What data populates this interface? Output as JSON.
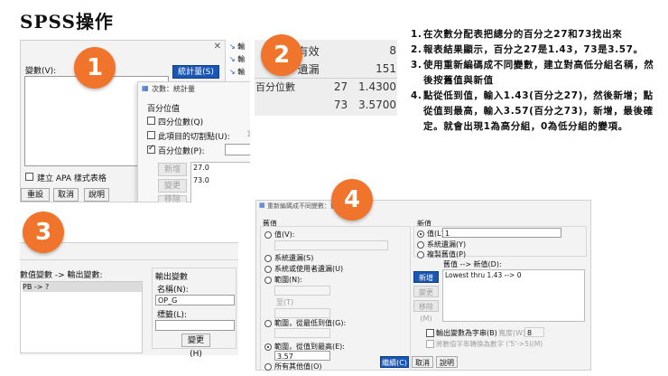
{
  "title": {
    "latin": "SPSS",
    "cjk": "操作"
  },
  "badges": [
    "1",
    "2",
    "3",
    "4"
  ],
  "panel1": {
    "vars_label": "變數(V):",
    "stats_button": "統計量(S)",
    "apa_label": "建立 APA 樣式表格",
    "reset": "重設(R)",
    "cancel": "取消",
    "help": "說明",
    "right_items": [
      "輸",
      "輸",
      "輸"
    ],
    "sub": {
      "title": "次數：統計量",
      "section": "百分位值",
      "quartiles": "四分位數(Q)",
      "cutpoints": "此項目的切割點(U):",
      "cutpoints_value": "10",
      "percentiles": "百分位數(P):",
      "add": "新增(A)",
      "change": "變更(C)",
      "remove": "移除(M)",
      "list": [
        "27.0",
        "73.0"
      ]
    }
  },
  "panel2": {
    "rows": [
      {
        "c1": "",
        "c2": "有效",
        "c3": "",
        "c4": "8"
      },
      {
        "c1": "",
        "c2": "遺漏",
        "c3": "",
        "c4": "151"
      },
      {
        "c1": "百分位數",
        "c2": "",
        "c3": "27",
        "c4": "1.4300"
      },
      {
        "c1": "",
        "c2": "",
        "c3": "73",
        "c4": "3.5700"
      }
    ]
  },
  "panel3": {
    "header_left": "數值變數 -> 輸出變數:",
    "list_item": "PB -> ?",
    "output_var": "輸出變數",
    "name_label": "名稱(N):",
    "name_value": "OP_G",
    "label_label": "標籤(L):",
    "change_button": "變更(H)"
  },
  "panel4": {
    "title": "重新編碼成不同變數：舊值與新值",
    "old_section": "舊值",
    "value": "值(V):",
    "sys_missing": "系統遺漏(S)",
    "sys_user_missing": "系統或使用者遺漏(U)",
    "range": "範圍(N):",
    "to": "至(T)",
    "range_low": "範圍，從最低到值(G):",
    "range_high": "範圍，從值到最高(E):",
    "range_high_value": "3.57",
    "all_other": "所有其他值(O)",
    "new_section": "新值",
    "new_value": "值(L):",
    "new_value_value": "1",
    "new_sys_missing": "系統遺漏(Y)",
    "copy_old": "複製舊值(P)",
    "old_new_label": "舊值 --> 新值(D):",
    "old_new_list": [
      "Lowest thru 1.43 --> 0"
    ],
    "add": "新增(A)",
    "change": "變更(C)",
    "remove": "移除(M)",
    "output_string": "輸出變數為字串(B)",
    "width": "寬度(W):",
    "width_value": "8",
    "convert": "將數值字串轉換為數字 ('5'->5)(M)",
    "continue": "繼續(C)",
    "cancel": "取消",
    "help": "說明"
  },
  "notes": [
    {
      "n": "1.",
      "text": "在次數分配表把總分的百分之27和73找出來"
    },
    {
      "n": "2.",
      "text": "報表結果顯示，百分之27是1.43，73是3.57。"
    },
    {
      "n": "3.",
      "text": "使用重新編碼成不同變數，建立對高低分組名稱，然後按舊值與新值"
    },
    {
      "n": "4.",
      "text": "點從低到值，輸入1.43(百分之27)，然後新增；點從值到最高，輸入3.57(百分之73)，新增，最後確定。就會出現1為高分組，0為低分組的變項。"
    }
  ],
  "colors": {
    "badge": "#f0742b",
    "accent_blue": "#1a57b5",
    "table_bg": "#eeeeee"
  }
}
